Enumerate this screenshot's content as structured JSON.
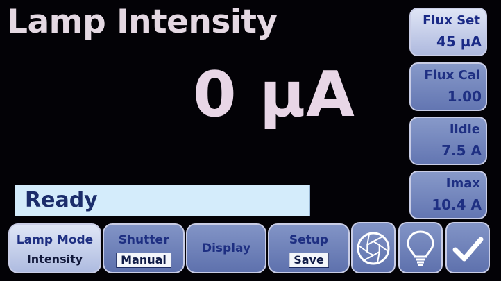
{
  "header": {
    "title": "Lamp Intensity"
  },
  "reading": {
    "value": "0 µA"
  },
  "status": {
    "text": "Ready"
  },
  "side_buttons": {
    "flux_set": {
      "label": "Flux Set",
      "value": "45 µA"
    },
    "flux_cal": {
      "label": "Flux Cal",
      "value": "1.00"
    },
    "iidle": {
      "label": "Iidle",
      "value": "7.5 A"
    },
    "imax": {
      "label": "Imax",
      "value": "10.4 A"
    }
  },
  "bottom_buttons": {
    "lamp_mode": {
      "label": "Lamp Mode",
      "value": "Intensity"
    },
    "shutter": {
      "label": "Shutter",
      "value": "Manual"
    },
    "display": {
      "label": "Display"
    },
    "setup": {
      "label": "Setup",
      "value": "Save"
    }
  },
  "icons": {
    "aperture": "aperture-icon",
    "lamp": "light-bulb-icon",
    "confirm": "checkmark-icon"
  },
  "colors": {
    "background": "#030206",
    "button_blue": "#6f82bc",
    "button_active": "#dfe5f5",
    "label_text": "#1e2f82",
    "status_bar": "#d4ecfb"
  }
}
